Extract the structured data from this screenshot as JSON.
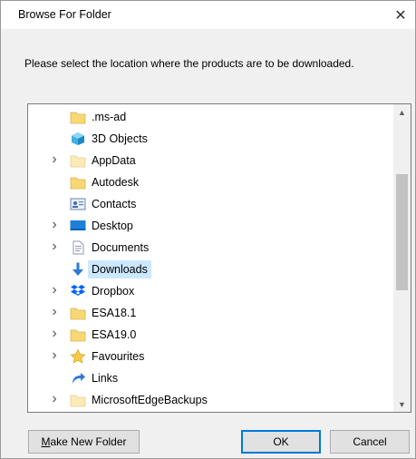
{
  "window": {
    "title": "Browse For Folder"
  },
  "instruction": "Please select the location where the products are to be downloaded.",
  "tree": {
    "items": [
      {
        "label": ".ms-ad",
        "icon": "folder-icon",
        "expandable": false,
        "selected": false
      },
      {
        "label": "3D Objects",
        "icon": "3d-objects-icon",
        "expandable": false,
        "selected": false
      },
      {
        "label": "AppData",
        "icon": "folder-light-icon",
        "expandable": true,
        "selected": false
      },
      {
        "label": "Autodesk",
        "icon": "folder-icon",
        "expandable": false,
        "selected": false
      },
      {
        "label": "Contacts",
        "icon": "contacts-icon",
        "expandable": false,
        "selected": false
      },
      {
        "label": "Desktop",
        "icon": "desktop-icon",
        "expandable": true,
        "selected": false
      },
      {
        "label": "Documents",
        "icon": "documents-icon",
        "expandable": true,
        "selected": false
      },
      {
        "label": "Downloads",
        "icon": "downloads-icon",
        "expandable": false,
        "selected": true
      },
      {
        "label": "Dropbox",
        "icon": "dropbox-icon",
        "expandable": true,
        "selected": false
      },
      {
        "label": "ESA18.1",
        "icon": "folder-icon",
        "expandable": true,
        "selected": false
      },
      {
        "label": "ESA19.0",
        "icon": "folder-icon",
        "expandable": true,
        "selected": false
      },
      {
        "label": "Favourites",
        "icon": "star-icon",
        "expandable": true,
        "selected": false
      },
      {
        "label": "Links",
        "icon": "links-icon",
        "expandable": false,
        "selected": false
      },
      {
        "label": "MicrosoftEdgeBackups",
        "icon": "folder-light-icon",
        "expandable": true,
        "selected": false
      }
    ]
  },
  "buttons": {
    "make_new_folder_mnemonic": "M",
    "make_new_folder_rest": "ake New Folder",
    "ok": "OK",
    "cancel": "Cancel"
  },
  "colors": {
    "selection": "#cce8ff",
    "focus_border": "#0078d7",
    "folder": "#f8d775"
  }
}
